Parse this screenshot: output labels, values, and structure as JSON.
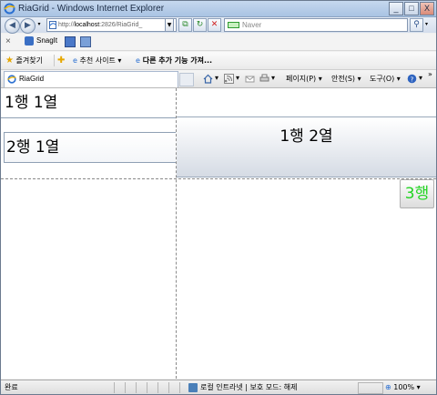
{
  "window": {
    "title": "RiaGrid - Windows Internet Explorer",
    "buttons": {
      "minimize": "_",
      "maximize": "□",
      "close": "X"
    }
  },
  "address_bar": {
    "url_prefix": "http://",
    "url_host": "localhost",
    "url_rest": ":2826/RiaGrid_",
    "search_placeholder": "Naver"
  },
  "toolbar": {
    "close_glyph": "×",
    "snagit_label": "SnagIt"
  },
  "favorites_bar": {
    "favorites_label": "즐겨찾기",
    "suggested_sites_label": "추천 사이트 ▾",
    "more_addons_label": "다른 추가 기능 가져..."
  },
  "tab_bar": {
    "tab_label": "RiaGrid",
    "page_menu": "페이지(P) ▾",
    "safety_menu": "안전(S) ▾",
    "tools_menu": "도구(O) ▾",
    "help_menu": "▾",
    "chevron": "»"
  },
  "grid": {
    "cell_r1c1": "1행 1열",
    "cell_r2c1": "2행 1열",
    "cell_r1c2": "1행 2열",
    "cell_r3": "3행",
    "r3_color": "#22d422"
  },
  "status_bar": {
    "status_text": "완료",
    "zone_text": "로컬 인트라넷 | 보호 모드: 해제",
    "zoom_text": "100% ▾"
  }
}
